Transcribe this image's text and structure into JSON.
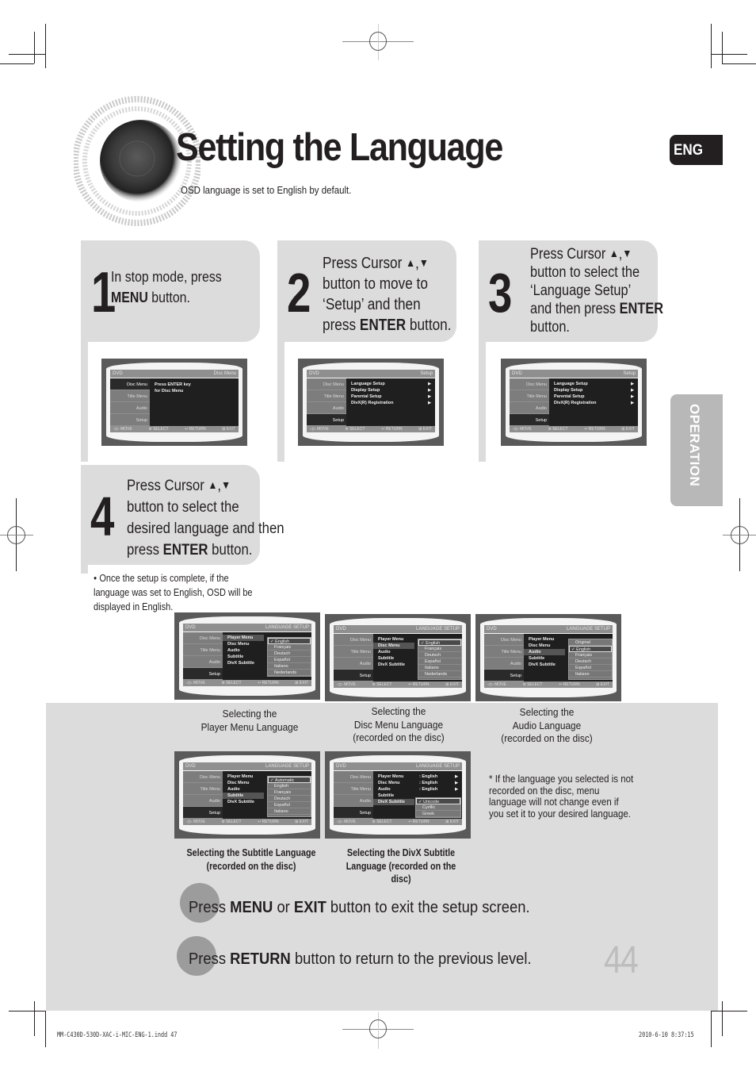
{
  "header": {
    "title": "Setting the Language",
    "subtitle": "OSD language is set to English by default.",
    "lang_tab": "ENG",
    "section_tab": "OPERATION"
  },
  "icons": {
    "up": "▲",
    "down": "▼",
    "bullet": "●",
    "star": "*"
  },
  "steps": [
    {
      "number": "1",
      "lines": [
        {
          "pre": "In stop mode, press",
          "bold": "",
          "post": ""
        },
        {
          "pre": "",
          "bold": "MENU",
          "post": " button."
        }
      ]
    },
    {
      "number": "2",
      "lines": [
        {
          "pre": "Press Cursor ",
          "bold": "",
          "post": ""
        },
        {
          "pre": "button to move to",
          "bold": "",
          "post": ""
        },
        {
          "pre": "‘Setup’ and then",
          "bold": "",
          "post": ""
        },
        {
          "pre": "press ",
          "bold": "ENTER",
          "post": " button."
        }
      ]
    },
    {
      "number": "3",
      "lines": [
        {
          "pre": "Press Cursor ",
          "bold": "",
          "post": ""
        },
        {
          "pre": "button to select the",
          "bold": "",
          "post": ""
        },
        {
          "pre": "‘Language Setup’",
          "bold": "",
          "post": ""
        },
        {
          "pre": "and then press ",
          "bold": "ENTER",
          "post": ""
        },
        {
          "pre": "button.",
          "bold": "",
          "post": ""
        }
      ]
    },
    {
      "number": "4",
      "lines": [
        {
          "pre": "Press Cursor ",
          "bold": "",
          "post": ""
        },
        {
          "pre": "button to select the",
          "bold": "",
          "post": ""
        },
        {
          "pre": "desired language and then",
          "bold": "",
          "post": ""
        },
        {
          "pre": "press ",
          "bold": "ENTER",
          "post": " button."
        }
      ]
    }
  ],
  "note_step4": "Once the setup is complete, if the language was set to English, OSD will be displayed in English.",
  "osd_common": {
    "brand": "DVD",
    "side_items": [
      "Disc Menu",
      "Title Menu",
      "Audio",
      "Setup"
    ],
    "footer": [
      "◁▷ MOVE",
      "⊚ SELECT",
      "↩ RETURN",
      "⊞ EXIT"
    ]
  },
  "screens": {
    "s1": {
      "header_right": "Disc Menu",
      "body": [
        "Press ENTER key",
        "for Disc Menu"
      ]
    },
    "s2": {
      "header_right": "Setup",
      "rows": [
        "Language Setup",
        "Display Setup",
        "Parental Setup",
        "DivX(R) Registration"
      ]
    },
    "s3": {
      "header_right": "Setup",
      "rows": [
        "Language Setup",
        "Display Setup",
        "Parental Setup",
        "DivX(R) Registration"
      ]
    },
    "lang_menu": {
      "header_right": "LANGUAGE SETUP",
      "rows": [
        "Player Menu",
        "Disc Menu",
        "Audio",
        "Subtitle",
        "DivX Subtitle"
      ]
    },
    "player": [
      "✓ English",
      "Français",
      "Deutsch",
      "Español",
      "Italiano",
      "Nederlands"
    ],
    "disc": [
      "✓ English",
      "Français",
      "Deutsch",
      "Español",
      "Italiano",
      "Nederlands"
    ],
    "audio": [
      "Original",
      "✓ English",
      "Français",
      "Deutsch",
      "Español",
      "Italiano"
    ],
    "subtitle": [
      "✓ Automatic",
      "English",
      "Français",
      "Deutsch",
      "Español",
      "Italiano"
    ],
    "divx_values": [
      ": English",
      ": English",
      ": English"
    ],
    "divx": [
      "✓ Unicode",
      "Cyrillic",
      "Greek"
    ]
  },
  "captions": {
    "player": [
      "Selecting the",
      "Player Menu Language"
    ],
    "disc": [
      "Selecting the",
      "Disc Menu Language",
      "(recorded on the disc)"
    ],
    "audio": [
      "Selecting the",
      "Audio Language",
      "(recorded on the disc)"
    ],
    "subtitle": [
      "Selecting the Subtitle Language",
      "(recorded on the disc)"
    ],
    "divx": [
      "Selecting the DivX Subtitle",
      "Language (recorded on the disc)"
    ]
  },
  "star_note": "If the language you selected is not recorded on the disc, menu language will not change even if you set it to your desired language.",
  "bottom": {
    "line1": {
      "a": "Press ",
      "b1": "MENU",
      "c": " or  ",
      "b2": "EXIT",
      "d": " button to exit the setup screen."
    },
    "line2": {
      "a": "Press ",
      "b1": "RETURN",
      "d": " button to return to the previous level."
    }
  },
  "page_number": "44",
  "footer": {
    "file": "MM-C430D-530D-XAC-i-MIC-ENG-1.indd   47",
    "date": "2010-6-10    8:37:15"
  }
}
